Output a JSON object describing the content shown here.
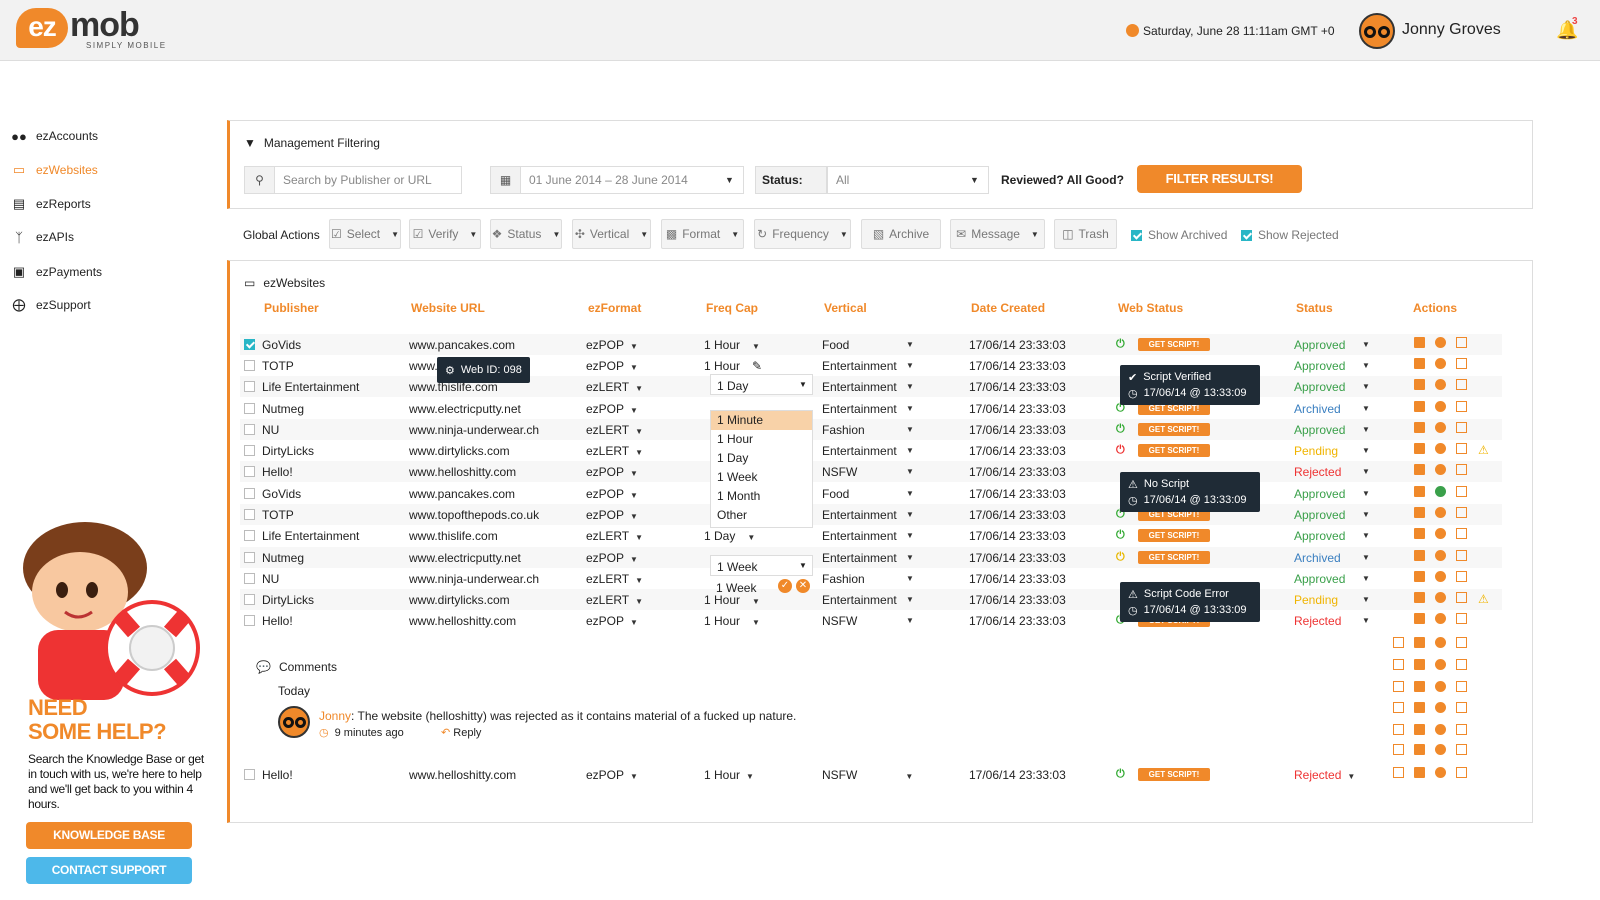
{
  "header": {
    "logo_ez": "ez",
    "logo_mob": "mob",
    "logo_tagline": "SIMPLY MOBILE",
    "datetime": "Saturday, June 28 11:11am GMT +0",
    "username": "Jonny Groves",
    "notification_count": "3"
  },
  "sidebar": {
    "items": [
      {
        "label": "ezAccounts",
        "icon": "users-icon"
      },
      {
        "label": "ezWebsites",
        "icon": "monitor-icon"
      },
      {
        "label": "ezReports",
        "icon": "bar-chart-icon"
      },
      {
        "label": "ezAPIs",
        "icon": "code-icon"
      },
      {
        "label": "ezPayments",
        "icon": "money-icon"
      },
      {
        "label": "ezSupport",
        "icon": "lifebuoy-icon"
      }
    ],
    "help": {
      "title_1": "NEED",
      "title_2": "SOME HELP?",
      "text": "Search the Knowledge Base or get in touch with us, we're here to help and we'll get back to you within 4 hours.",
      "kb_label": "KNOWLEDGE BASE",
      "support_label": "CONTACT SUPPORT"
    }
  },
  "filter": {
    "title": "Management Filtering",
    "search_placeholder": "Search by Publisher or URL",
    "date_range": "01 June 2014 – 28 June 2014",
    "status_label": "Status:",
    "status_value": "All",
    "reviewed_label": "Reviewed? All Good?",
    "button_label": "FILTER RESULTS!"
  },
  "global_actions": {
    "label": "Global Actions",
    "buttons": [
      "Select",
      "Verify",
      "Status",
      "Vertical",
      "Format",
      "Frequency",
      "Archive",
      "Message",
      "Trash"
    ],
    "show_archived": "Show Archived",
    "show_rejected": "Show Rejected"
  },
  "websites": {
    "title": "ezWebsites",
    "columns": [
      "Publisher",
      "Website URL",
      "ezFormat",
      "Freq Cap",
      "Vertical",
      "Date Created",
      "Web Status",
      "Status",
      "Actions"
    ],
    "get_script_label": "GET SCRIPT!",
    "rows": [
      {
        "publisher": "GoVids",
        "url": "www.pancakes.com",
        "format": "ezPOP",
        "freq": "1 Hour",
        "vertical": "Food",
        "date": "17/06/14 23:33:03",
        "web": "green",
        "status": "Approved",
        "st": "approved",
        "checked": true
      },
      {
        "publisher": "TOTP",
        "url": "www.",
        "format": "ezPOP",
        "freq": "1 Hour",
        "vertical": "Entertainment",
        "date": "17/06/14 23:33:03",
        "web": "",
        "status": "Approved",
        "st": "approved"
      },
      {
        "publisher": "Life Entertainment",
        "url": "www.thislife.com",
        "format": "ezLERT",
        "freq": "1 Day",
        "vertical": "Entertainment",
        "date": "17/06/14 23:33:03",
        "web": "",
        "status": "Approved",
        "st": "approved"
      },
      {
        "publisher": "Nutmeg",
        "url": "www.electricputty.net",
        "format": "ezPOP",
        "freq": "",
        "vertical": "Entertainment",
        "date": "17/06/14 23:33:03",
        "web": "green",
        "status": "Archived",
        "st": "archived"
      },
      {
        "publisher": "NU",
        "url": "www.ninja-underwear.ch",
        "format": "ezLERT",
        "freq": "",
        "vertical": "Fashion",
        "date": "17/06/14 23:33:03",
        "web": "green",
        "status": "Approved",
        "st": "approved"
      },
      {
        "publisher": "DirtyLicks",
        "url": "www.dirtylicks.com",
        "format": "ezLERT",
        "freq": "",
        "vertical": "Entertainment",
        "date": "17/06/14 23:33:03",
        "web": "red",
        "status": "Pending",
        "st": "pending",
        "warn": true
      },
      {
        "publisher": "Hello!",
        "url": "www.helloshitty.com",
        "format": "ezPOP",
        "freq": "",
        "vertical": "NSFW",
        "date": "17/06/14 23:33:03",
        "web": "",
        "status": "Rejected",
        "st": "rejected"
      },
      {
        "publisher": "GoVids",
        "url": "www.pancakes.com",
        "format": "ezPOP",
        "freq": "",
        "vertical": "Food",
        "date": "17/06/14 23:33:03",
        "web": "",
        "status": "Approved",
        "st": "approved",
        "green_chat": true
      },
      {
        "publisher": "TOTP",
        "url": "www.topofthepods.co.uk",
        "format": "ezPOP",
        "freq": "",
        "vertical": "Entertainment",
        "date": "17/06/14 23:33:03",
        "web": "green",
        "status": "Approved",
        "st": "approved"
      },
      {
        "publisher": "Life Entertainment",
        "url": "www.thislife.com",
        "format": "ezLERT",
        "freq": "1 Day",
        "vertical": "Entertainment",
        "date": "17/06/14 23:33:03",
        "web": "green",
        "status": "Approved",
        "st": "approved"
      },
      {
        "publisher": "Nutmeg",
        "url": "www.electricputty.net",
        "format": "ezPOP",
        "freq": "1 Week",
        "vertical": "Entertainment",
        "date": "17/06/14 23:33:03",
        "web": "yellow",
        "status": "Archived",
        "st": "archived"
      },
      {
        "publisher": "NU",
        "url": "www.ninja-underwear.ch",
        "format": "ezLERT",
        "freq": "1 Week",
        "vertical": "Fashion",
        "date": "17/06/14 23:33:03",
        "web": "",
        "status": "Approved",
        "st": "approved"
      },
      {
        "publisher": "DirtyLicks",
        "url": "www.dirtylicks.com",
        "format": "ezLERT",
        "freq": "1 Hour",
        "vertical": "Entertainment",
        "date": "17/06/14 23:33:03",
        "web": "",
        "status": "Pending",
        "st": "pending",
        "warn": true
      },
      {
        "publisher": "Hello!",
        "url": "www.helloshitty.com",
        "format": "ezPOP",
        "freq": "1 Hour",
        "vertical": "NSFW",
        "date": "17/06/14 23:33:03",
        "web": "green",
        "status": "Rejected",
        "st": "rejected"
      }
    ],
    "last_row": {
      "publisher": "Hello!",
      "url": "www.helloshitty.com",
      "format": "ezPOP",
      "freq": "1 Hour",
      "vertical": "NSFW",
      "date": "17/06/14 23:33:03",
      "status": "Rejected"
    },
    "freq_options": [
      "1 Minute",
      "1 Hour",
      "1 Day",
      "1 Week",
      "1 Month",
      "Other"
    ],
    "tooltips": {
      "web_id": "Web ID: 098",
      "verified_title": "Script Verified",
      "verified_time": "17/06/14 @ 13:33:09",
      "noscript_title": "No Script",
      "noscript_time": "17/06/14 @ 13:33:09",
      "error_title": "Script Code Error",
      "error_time": "17/06/14 @ 13:33:09"
    }
  },
  "comments": {
    "title": "Comments",
    "day": "Today",
    "author": "Jonny",
    "text": ": The website (helloshitty) was rejected as it contains material of a fucked up nature.",
    "time": "9 minutes ago",
    "reply": "Reply"
  }
}
